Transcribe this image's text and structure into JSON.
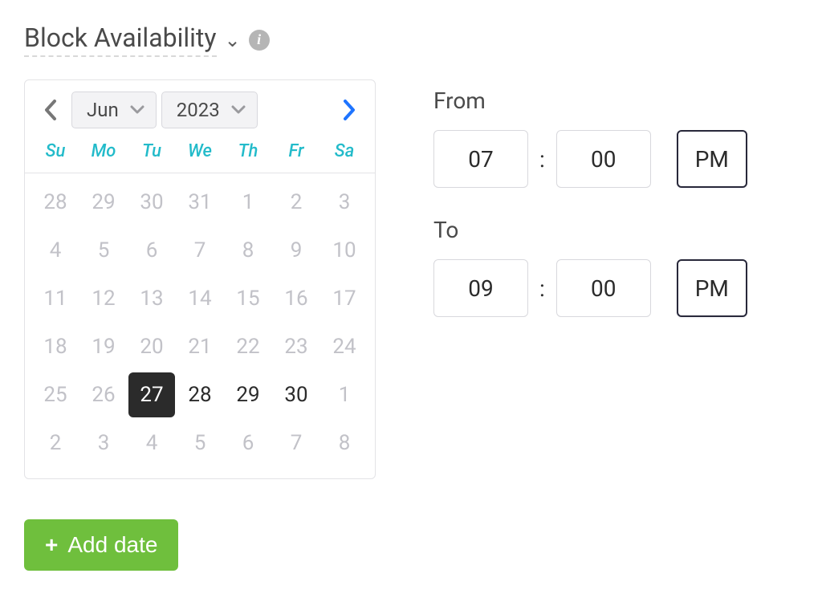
{
  "header": {
    "title": "Block Availability"
  },
  "calendar": {
    "month": "Jun",
    "year": "2023",
    "weekdays": [
      "Su",
      "Mo",
      "Tu",
      "We",
      "Th",
      "Fr",
      "Sa"
    ],
    "cells": [
      {
        "n": "28",
        "state": "other-month"
      },
      {
        "n": "29",
        "state": "other-month"
      },
      {
        "n": "30",
        "state": "other-month"
      },
      {
        "n": "31",
        "state": "other-month"
      },
      {
        "n": "1",
        "state": "disabled"
      },
      {
        "n": "2",
        "state": "disabled"
      },
      {
        "n": "3",
        "state": "disabled"
      },
      {
        "n": "4",
        "state": "disabled"
      },
      {
        "n": "5",
        "state": "disabled"
      },
      {
        "n": "6",
        "state": "disabled"
      },
      {
        "n": "7",
        "state": "disabled"
      },
      {
        "n": "8",
        "state": "disabled"
      },
      {
        "n": "9",
        "state": "disabled"
      },
      {
        "n": "10",
        "state": "disabled"
      },
      {
        "n": "11",
        "state": "disabled"
      },
      {
        "n": "12",
        "state": "disabled"
      },
      {
        "n": "13",
        "state": "disabled"
      },
      {
        "n": "14",
        "state": "disabled"
      },
      {
        "n": "15",
        "state": "disabled"
      },
      {
        "n": "16",
        "state": "disabled"
      },
      {
        "n": "17",
        "state": "disabled"
      },
      {
        "n": "18",
        "state": "disabled"
      },
      {
        "n": "19",
        "state": "disabled"
      },
      {
        "n": "20",
        "state": "disabled"
      },
      {
        "n": "21",
        "state": "disabled"
      },
      {
        "n": "22",
        "state": "disabled"
      },
      {
        "n": "23",
        "state": "disabled"
      },
      {
        "n": "24",
        "state": "disabled"
      },
      {
        "n": "25",
        "state": "disabled"
      },
      {
        "n": "26",
        "state": "disabled"
      },
      {
        "n": "27",
        "state": "selected"
      },
      {
        "n": "28",
        "state": "active"
      },
      {
        "n": "29",
        "state": "active"
      },
      {
        "n": "30",
        "state": "active"
      },
      {
        "n": "1",
        "state": "other-month"
      },
      {
        "n": "2",
        "state": "other-month"
      },
      {
        "n": "3",
        "state": "other-month"
      },
      {
        "n": "4",
        "state": "other-month"
      },
      {
        "n": "5",
        "state": "other-month"
      },
      {
        "n": "6",
        "state": "other-month"
      },
      {
        "n": "7",
        "state": "other-month"
      },
      {
        "n": "8",
        "state": "other-month"
      }
    ]
  },
  "time": {
    "from_label": "From",
    "to_label": "To",
    "from_hour": "07",
    "from_min": "00",
    "from_ampm": "PM",
    "to_hour": "09",
    "to_min": "00",
    "to_ampm": "PM",
    "colon": ":"
  },
  "buttons": {
    "add_date": "Add date"
  },
  "icons": {
    "plus": "+",
    "info": "i",
    "chevron_down": "⌄"
  }
}
